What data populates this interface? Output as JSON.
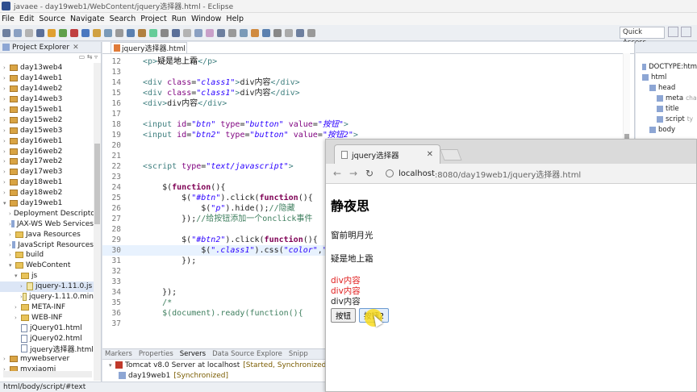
{
  "window": {
    "title": "javaee - day19web1/WebContent/jquery选择器.html - Eclipse"
  },
  "menu": [
    "File",
    "Edit",
    "Source",
    "Navigate",
    "Search",
    "Project",
    "Run",
    "Window",
    "Help"
  ],
  "toolbar": {
    "quick_access": "Quick Access"
  },
  "project_explorer": {
    "title": "Project Explorer",
    "close": "✕",
    "items": [
      {
        "label": "day13web4",
        "type": "project",
        "indent": 0
      },
      {
        "label": "day14web1",
        "type": "project",
        "indent": 0
      },
      {
        "label": "day14web2",
        "type": "project",
        "indent": 0
      },
      {
        "label": "day14web3",
        "type": "project",
        "indent": 0
      },
      {
        "label": "day15web1",
        "type": "project",
        "indent": 0
      },
      {
        "label": "day15web2",
        "type": "project",
        "indent": 0
      },
      {
        "label": "day15web3",
        "type": "project",
        "indent": 0
      },
      {
        "label": "day16web1",
        "type": "project",
        "indent": 0
      },
      {
        "label": "day16web2",
        "type": "project",
        "indent": 0
      },
      {
        "label": "day17web2",
        "type": "project",
        "indent": 0
      },
      {
        "label": "day17web3",
        "type": "project",
        "indent": 0
      },
      {
        "label": "day18web1",
        "type": "project",
        "indent": 0
      },
      {
        "label": "day18web2",
        "type": "project",
        "indent": 0
      },
      {
        "label": "day19web1",
        "type": "project",
        "indent": 0,
        "open": true
      },
      {
        "label": "Deployment Descripto",
        "type": "lib",
        "indent": 1
      },
      {
        "label": "JAX-WS Web Services",
        "type": "lib",
        "indent": 1
      },
      {
        "label": "Java Resources",
        "type": "folder",
        "indent": 1
      },
      {
        "label": "JavaScript Resources",
        "type": "lib",
        "indent": 1
      },
      {
        "label": "build",
        "type": "folder",
        "indent": 1
      },
      {
        "label": "WebContent",
        "type": "folder",
        "indent": 1,
        "open": true
      },
      {
        "label": "js",
        "type": "folder",
        "indent": 2,
        "open": true
      },
      {
        "label": "jquery-1.11.0.js",
        "type": "js",
        "indent": 3,
        "selected": true
      },
      {
        "label": "jquery-1.11.0.min",
        "type": "js",
        "indent": 3
      },
      {
        "label": "META-INF",
        "type": "folder",
        "indent": 2
      },
      {
        "label": "WEB-INF",
        "type": "folder",
        "indent": 2
      },
      {
        "label": "jQuery01.html",
        "type": "file",
        "indent": 2
      },
      {
        "label": "jQuery02.html",
        "type": "file",
        "indent": 2
      },
      {
        "label": "jquery选择器.html",
        "type": "file",
        "indent": 2
      },
      {
        "label": "mywebserver",
        "type": "project",
        "indent": 0
      },
      {
        "label": "myxiaomi",
        "type": "project",
        "indent": 0
      }
    ]
  },
  "editor": {
    "tab_label": "jquery选择器.html",
    "lines": [
      {
        "n": "12",
        "html": "<span class='tag'>&lt;p&gt;</span><span class='txt'>疑是地上霜</span><span class='tag'>&lt;/p&gt;</span>"
      },
      {
        "n": "13",
        "html": ""
      },
      {
        "n": "14",
        "html": "<span class='tag'>&lt;div </span><span class='attr'>class</span>=<span class='str'>\"class1\"</span><span class='tag'>&gt;</span>div内容<span class='tag'>&lt;/div&gt;</span>"
      },
      {
        "n": "15",
        "html": "<span class='tag'>&lt;div </span><span class='attr'>class</span>=<span class='str'>\"class1\"</span><span class='tag'>&gt;</span>div内容<span class='tag'>&lt;/div&gt;</span>"
      },
      {
        "n": "16",
        "html": "<span class='tag'>&lt;div&gt;</span>div内容<span class='tag'>&lt;/div&gt;</span>"
      },
      {
        "n": "17",
        "html": ""
      },
      {
        "n": "18",
        "html": "<span class='tag'>&lt;input </span><span class='attr'>id</span>=<span class='str'>\"btn\"</span> <span class='attr'>type</span>=<span class='str'>\"button\"</span> <span class='attr'>value</span>=<span class='str'>\"按钮\"</span><span class='tag'>&gt;</span>"
      },
      {
        "n": "19",
        "html": "<span class='tag'>&lt;input </span><span class='attr'>id</span>=<span class='str'>\"btn2\"</span> <span class='attr'>type</span>=<span class='str'>\"button\"</span> <span class='attr'>value</span>=<span class='str'>\"按钮2\"</span><span class='tag'>&gt;</span>"
      },
      {
        "n": "20",
        "html": ""
      },
      {
        "n": "21",
        "html": ""
      },
      {
        "n": "22",
        "html": "<span class='tag'>&lt;script </span><span class='attr'>type</span>=<span class='str'>\"text/javascript\"</span><span class='tag'>&gt;</span>"
      },
      {
        "n": "23",
        "html": ""
      },
      {
        "n": "24",
        "html": "    $(<span class='kw'>function</span>(){"
      },
      {
        "n": "25",
        "html": "        $(<span class='str'>\"#btn\"</span>).click(<span class='kw'>function</span>(){"
      },
      {
        "n": "26",
        "html": "            $(<span class='str'>\"p\"</span>).hide();<span class='cm'>//隐藏</span>"
      },
      {
        "n": "27",
        "html": "        });<span class='cm'>//给按钮添加一个onclick事件</span>"
      },
      {
        "n": "28",
        "html": ""
      },
      {
        "n": "29",
        "html": "        $(<span class='str'>\"#btn2\"</span>).click(<span class='kw'>function</span>(){"
      },
      {
        "n": "30",
        "html": "            $(<span class='str'>\".class1\"</span>).css(<span class='str'>\"color\"</span>,<span class='str'>\"red\"</span>);",
        "hl": true
      },
      {
        "n": "31",
        "html": "        });"
      },
      {
        "n": "32",
        "html": ""
      },
      {
        "n": "33",
        "html": ""
      },
      {
        "n": "34",
        "html": "    });"
      },
      {
        "n": "35",
        "html": "    <span class='cm'>/*</span>"
      },
      {
        "n": "36",
        "html": "    <span class='cm'>$(document).ready(function(){</span>"
      },
      {
        "n": "37",
        "html": ""
      }
    ]
  },
  "outline": {
    "items": [
      {
        "label": "DOCTYPE:htm",
        "indent": 0
      },
      {
        "label": "html",
        "indent": 0
      },
      {
        "label": "head",
        "indent": 1
      },
      {
        "label": "meta",
        "small": "cha",
        "indent": 2
      },
      {
        "label": "title",
        "indent": 2
      },
      {
        "label": "script",
        "small": "ty",
        "indent": 2
      },
      {
        "label": "body",
        "indent": 1
      }
    ]
  },
  "bottom_panel": {
    "tabs": [
      "Markers",
      "Properties",
      "Servers",
      "Data Source Explore",
      "Snipp"
    ],
    "server": "Tomcat v8.0 Server at localhost",
    "server_state": "[Started, Synchronized]",
    "module": "day19web1",
    "module_state": "[Synchronized]"
  },
  "statusbar": {
    "path": "html/body/script/#text"
  },
  "browser": {
    "tab_title": "jquery选择器",
    "tab_close": "✕",
    "url_host": "localhost",
    "url_rest": ":8080/day19web1/jquery选择器.html",
    "content": {
      "heading": "静夜思",
      "line1": "窗前明月光",
      "line2": "疑是地上霜",
      "div1": "div内容",
      "div2": "div内容",
      "div3": "div内容",
      "btn1": "按钮",
      "btn2": "按钮2"
    }
  }
}
